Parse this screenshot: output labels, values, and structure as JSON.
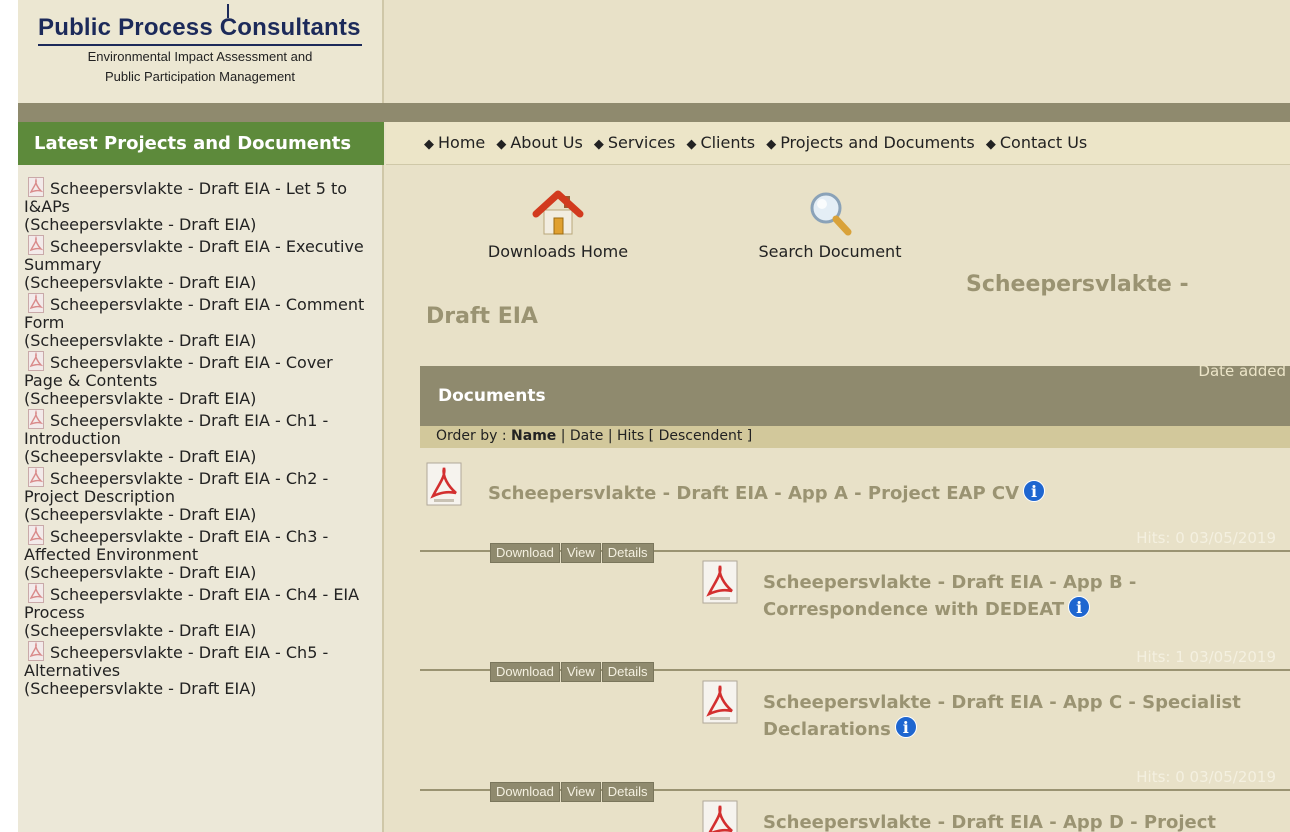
{
  "logo": {
    "title": "Public Process Consultants",
    "subtitle_line1": "Environmental Impact Assessment and",
    "subtitle_line2": "Public Participation Management"
  },
  "sidebar": {
    "heading": "Latest Projects and Documents",
    "items": [
      {
        "title": "Scheepersvlakte - Draft EIA - Let 5 to I&APs",
        "sub": "(Scheepersvlakte - Draft EIA)"
      },
      {
        "title": "Scheepersvlakte - Draft EIA - Executive Summary",
        "sub": "(Scheepersvlakte - Draft EIA)"
      },
      {
        "title": "Scheepersvlakte - Draft EIA - Comment Form",
        "sub": "(Scheepersvlakte - Draft EIA)"
      },
      {
        "title": "Scheepersvlakte - Draft EIA - Cover Page & Contents",
        "sub": "(Scheepersvlakte - Draft EIA)"
      },
      {
        "title": "Scheepersvlakte - Draft EIA - Ch1 - Introduction",
        "sub": "(Scheepersvlakte - Draft EIA)"
      },
      {
        "title": "Scheepersvlakte - Draft EIA - Ch2 - Project Description",
        "sub": "(Scheepersvlakte - Draft EIA)"
      },
      {
        "title": "Scheepersvlakte - Draft EIA - Ch3 - Affected Environment",
        "sub": "(Scheepersvlakte - Draft EIA)"
      },
      {
        "title": "Scheepersvlakte - Draft EIA - Ch4 - EIA Process",
        "sub": "(Scheepersvlakte - Draft EIA)"
      },
      {
        "title": "Scheepersvlakte - Draft EIA - Ch5 - Alternatives",
        "sub": "(Scheepersvlakte - Draft EIA)"
      }
    ]
  },
  "nav": {
    "diamond": "◆",
    "items": [
      "Home",
      "About Us",
      "Services",
      "Clients",
      "Projects and Documents",
      "Contact Us"
    ]
  },
  "tools": {
    "home_label": "Downloads Home",
    "search_label": "Search Document"
  },
  "category": {
    "heading_part1": "Scheepersvlakte -",
    "heading_part2": "Draft EIA"
  },
  "documents": {
    "bar_title": "Documents",
    "date_header": "Date added",
    "order_prefix": "Order by :",
    "order_name": "Name",
    "order_date": "Date",
    "order_hits": "Hits",
    "order_direction": "[ Descendent ]",
    "sep": "|",
    "buttons": {
      "download": "Download",
      "view": "View",
      "details": "Details"
    },
    "info_glyph": "i",
    "items": [
      {
        "line1": "Scheepersvlakte - Draft EIA - App A - Project EAP CV",
        "line2": "",
        "hits": "Hits: 0 03/05/2019"
      },
      {
        "line1": "Scheepersvlakte - Draft EIA - App B -",
        "line2": "Correspondence with DEDEAT",
        "hits": "Hits: 1 03/05/2019"
      },
      {
        "line1": "Scheepersvlakte - Draft EIA - App C - Specialist",
        "line2": "Declarations",
        "hits": "Hits: 0 03/05/2019"
      },
      {
        "line1": "Scheepersvlakte - Draft EIA - App D - Project",
        "line2": "",
        "hits": ""
      }
    ]
  },
  "colors": {
    "accent_green": "#5d8a3b",
    "olive_bar": "#8f8a6e",
    "info_blue": "#1e66d0",
    "pdf_red": "#d32f2f"
  }
}
